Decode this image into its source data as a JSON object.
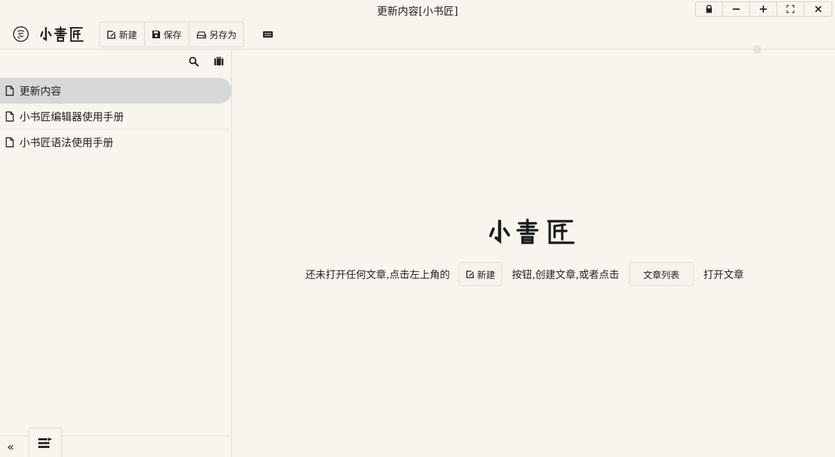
{
  "window": {
    "title": "更新内容[小书匠]"
  },
  "window_controls": [
    {
      "name": "lock-icon"
    },
    {
      "name": "minimize-icon"
    },
    {
      "name": "maximize-icon"
    },
    {
      "name": "fullscreen-icon"
    },
    {
      "name": "close-icon"
    }
  ],
  "toolbar": {
    "new_label": "新建",
    "save_label": "保存",
    "save_as_label": "另存为"
  },
  "sidebar": {
    "documents": [
      {
        "title": "更新内容",
        "active": true
      },
      {
        "title": "小书匠编辑器使用手册",
        "active": false
      },
      {
        "title": "小书匠语法使用手册",
        "active": false
      }
    ],
    "collapse_label": "«"
  },
  "main": {
    "hint_before": "还未打开任何文章,点击左上角的",
    "hint_new_button": "新建",
    "hint_middle": "按钮,创建文章,或者点击",
    "hint_list_button": "文章列表",
    "hint_after": "打开文章"
  },
  "colors": {
    "background": "#f8f4ee",
    "active_item": "#d8d8d6",
    "border": "#e2ddd5"
  }
}
